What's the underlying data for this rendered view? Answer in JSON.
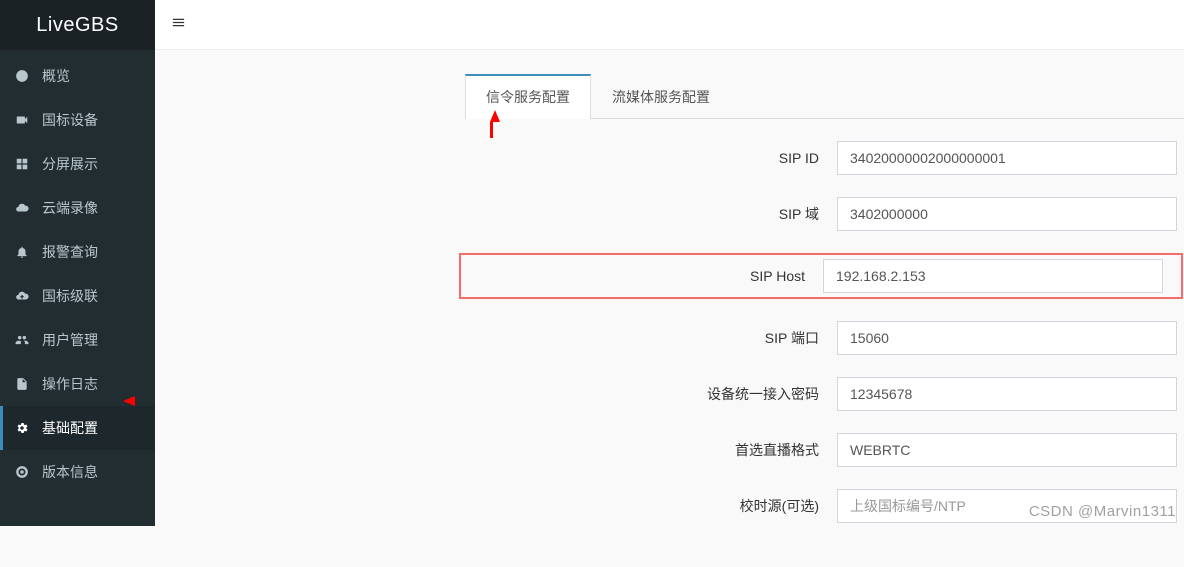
{
  "brand": "LiveGBS",
  "sidebar": {
    "items": [
      {
        "label": "概览",
        "icon": "dashboard"
      },
      {
        "label": "国标设备",
        "icon": "camera"
      },
      {
        "label": "分屏展示",
        "icon": "grid"
      },
      {
        "label": "云端录像",
        "icon": "cloud"
      },
      {
        "label": "报警查询",
        "icon": "bell"
      },
      {
        "label": "国标级联",
        "icon": "cloud-up"
      },
      {
        "label": "用户管理",
        "icon": "users"
      },
      {
        "label": "操作日志",
        "icon": "file"
      },
      {
        "label": "基础配置",
        "icon": "cogs"
      },
      {
        "label": "版本信息",
        "icon": "support"
      }
    ]
  },
  "tabs": [
    {
      "label": "信令服务配置",
      "active": true
    },
    {
      "label": "流媒体服务配置",
      "active": false
    }
  ],
  "form": {
    "sip_id": {
      "label": "SIP ID",
      "value": "34020000002000000001"
    },
    "sip_domain": {
      "label": "SIP 域",
      "value": "3402000000"
    },
    "sip_host": {
      "label": "SIP Host",
      "value": "192.168.2.153"
    },
    "sip_port": {
      "label": "SIP 端口",
      "value": "15060"
    },
    "device_pwd": {
      "label": "设备统一接入密码",
      "value": "12345678"
    },
    "preferred_fmt": {
      "label": "首选直播格式",
      "value": "WEBRTC"
    },
    "ntp_src": {
      "label": "校时源(可选)",
      "value": "",
      "placeholder": "上级国标编号/NTP"
    }
  },
  "watermark": "CSDN @Marvin1311"
}
